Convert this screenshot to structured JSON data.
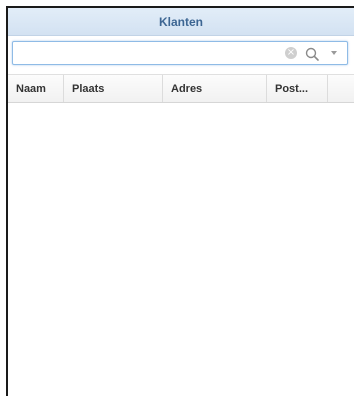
{
  "window": {
    "title": "Klanten"
  },
  "search": {
    "value": "",
    "placeholder": "",
    "icons": [
      "clear-icon",
      "search-icon",
      "chevron-down-icon"
    ]
  },
  "table": {
    "columns": [
      {
        "label": "Naam"
      },
      {
        "label": "Plaats"
      },
      {
        "label": "Adres"
      },
      {
        "label": "Post..."
      },
      {
        "label": ""
      }
    ],
    "rows": []
  },
  "colors": {
    "titlebar_bg": "#dbe7f5",
    "title_text": "#3d6693",
    "search_border": "#8fbbe6"
  }
}
